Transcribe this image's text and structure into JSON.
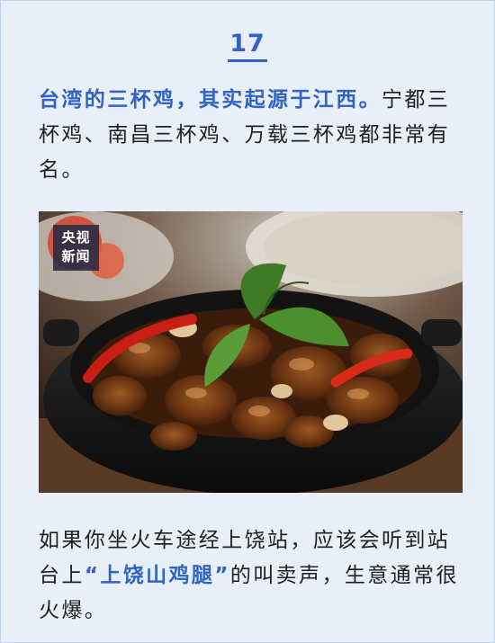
{
  "item_number": "17",
  "para1": {
    "highlight": "台湾的三杯鸡，其实起源于江西。",
    "rest": "宁都三杯鸡、南昌三杯鸡、万载三杯鸡都非常有名。"
  },
  "photo": {
    "logo_line1": "央视",
    "logo_line2": "新闻"
  },
  "para2": {
    "before": "如果你坐火车途经上饶站，应该会听到站台上",
    "highlight": "“上饶山鸡腿”",
    "after": "的叫卖声，生意通常很火爆。"
  }
}
